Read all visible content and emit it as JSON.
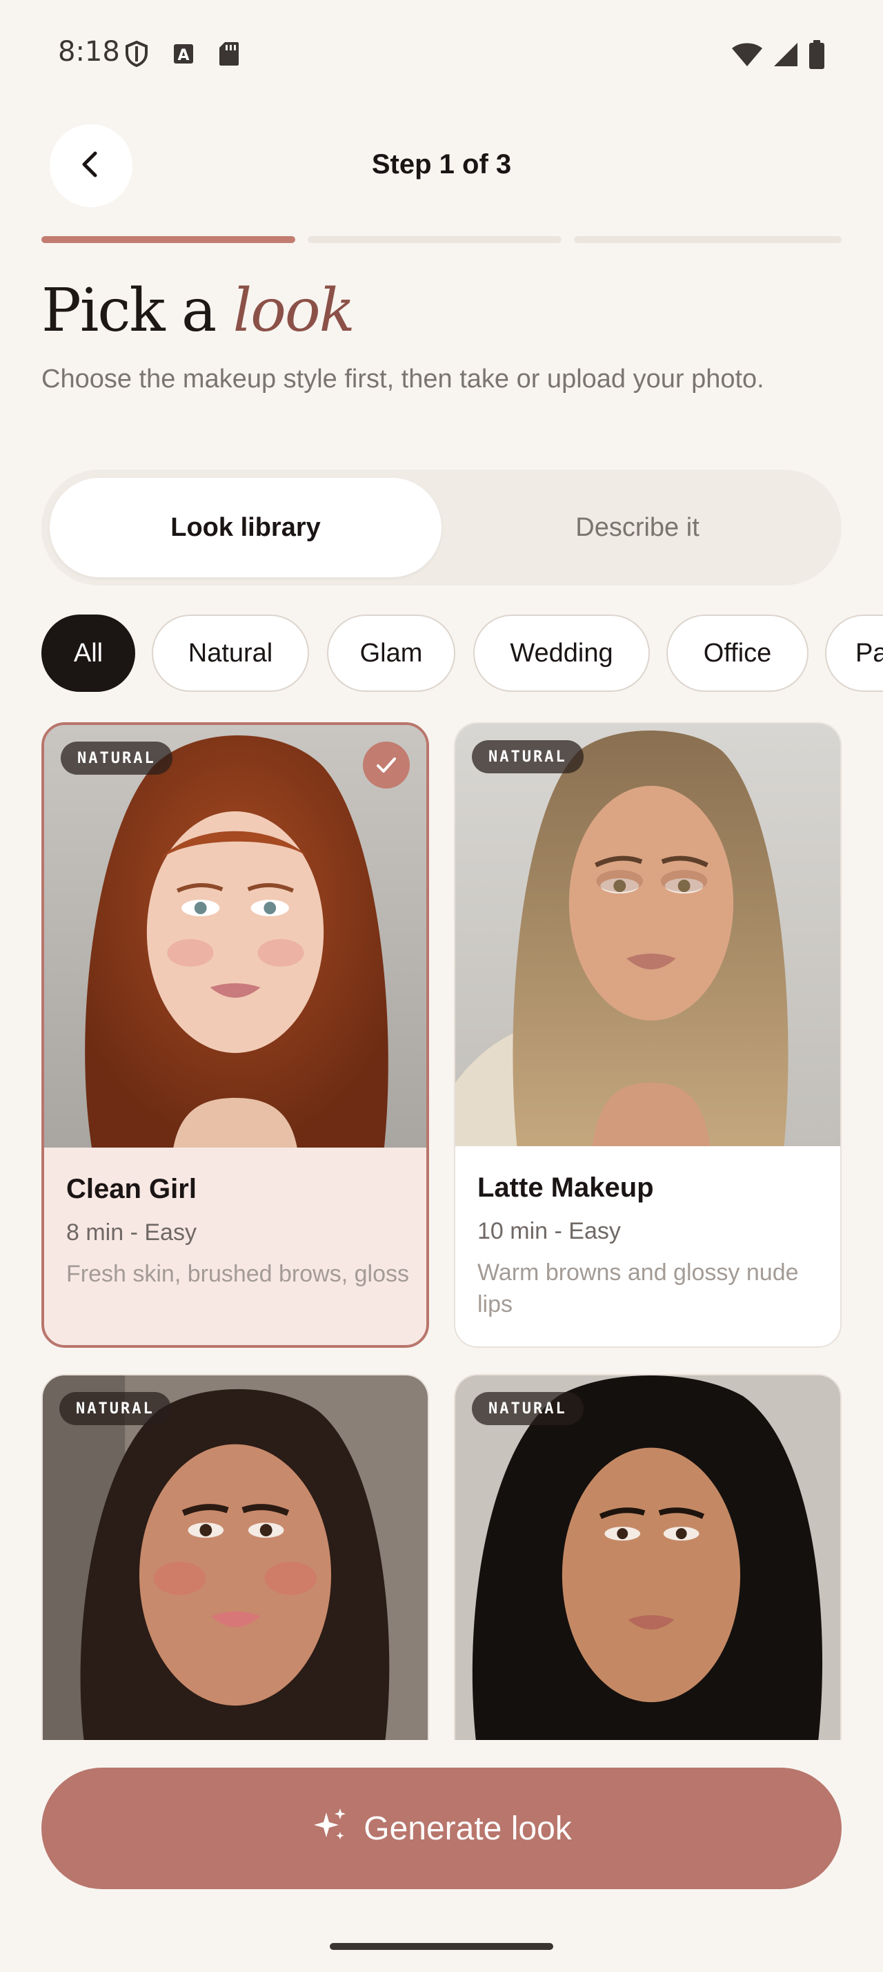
{
  "status_bar": {
    "time": "8:18",
    "left_icons": [
      "shield-icon",
      "font-icon",
      "sd-card-icon"
    ],
    "right_icons": [
      "wifi-icon",
      "signal-icon",
      "battery-icon"
    ]
  },
  "header": {
    "back_icon": "chevron-left-icon",
    "step_title": "Step 1 of 3",
    "progress": {
      "current_step": 1,
      "total_steps": 3
    }
  },
  "intro": {
    "title_plain": "Pick a",
    "title_accent": "look",
    "subtitle": "Choose the makeup style first, then take or upload your photo."
  },
  "segmented": {
    "options": [
      "Look library",
      "Describe it"
    ],
    "selected": "Look library"
  },
  "filters": {
    "chips": [
      "All",
      "Natural",
      "Glam",
      "Wedding",
      "Office",
      "Pa"
    ],
    "selected": "All"
  },
  "looks": [
    {
      "badge": "NATURAL",
      "title": "Clean Girl",
      "meta": "8 min - Easy",
      "description": "Fresh skin, brushed brows, gloss",
      "selected": true
    },
    {
      "badge": "NATURAL",
      "title": "Latte Makeup",
      "meta": "10 min - Easy",
      "description": "Warm browns and glossy nude lips",
      "selected": false
    },
    {
      "badge": "NATURAL"
    },
    {
      "badge": "NATURAL"
    }
  ],
  "cta": {
    "label": "Generate look",
    "icon": "sparkle-icon"
  },
  "colors": {
    "background": "#f8f5f1",
    "accent": "#b8766c",
    "accent_text": "#8b5148",
    "dark": "#1b1514"
  }
}
